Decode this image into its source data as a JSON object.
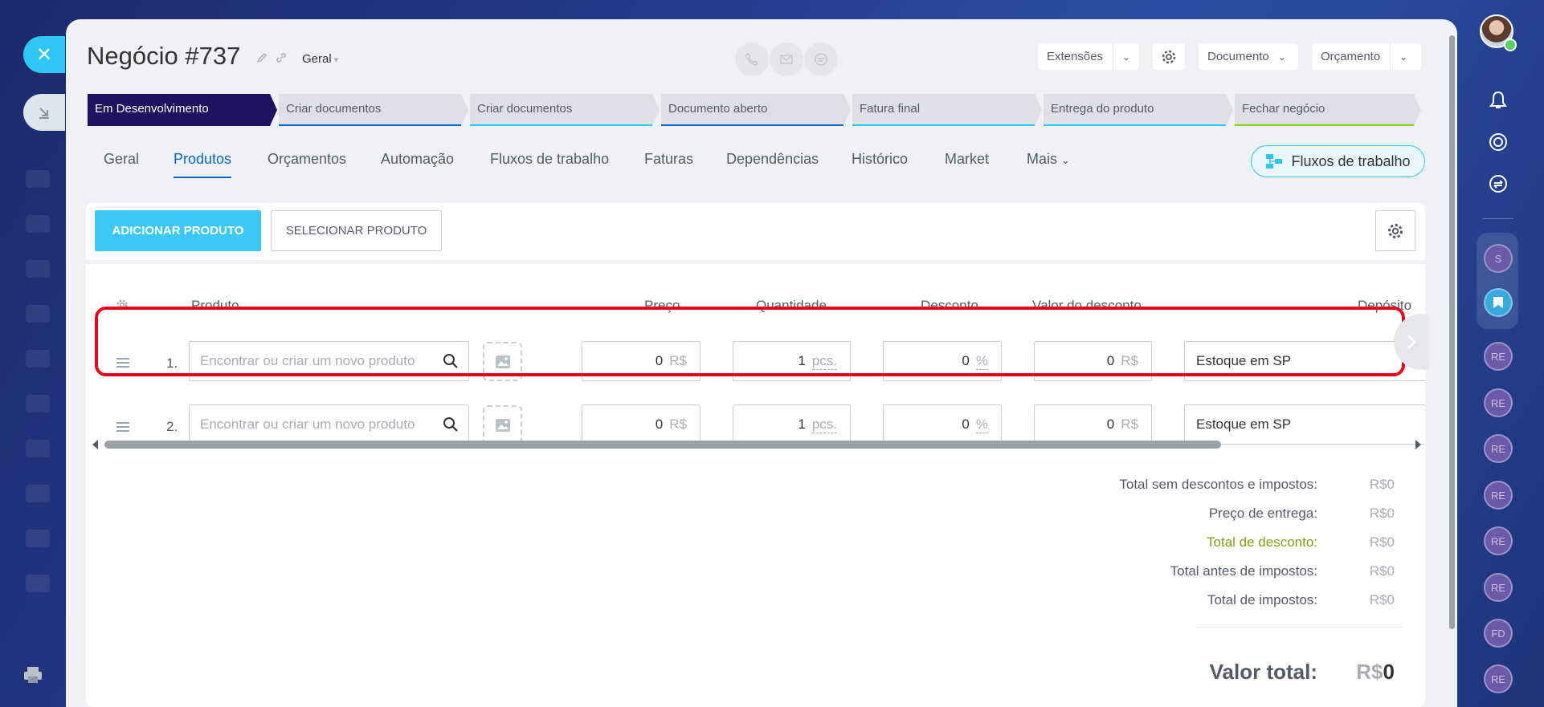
{
  "deal": {
    "title": "Negócio #737",
    "category": "Geral"
  },
  "header_buttons": {
    "extensions": "Extensões",
    "document": "Documento",
    "quote": "Orçamento"
  },
  "stages": [
    {
      "label": "Em Desenvolvimento",
      "color": "#1e1360"
    },
    {
      "label": "Criar documentos",
      "color": "#0b66c3"
    },
    {
      "label": "Criar documentos",
      "color": "#2fc6f6"
    },
    {
      "label": "Documento aberto",
      "color": "#0b66c3"
    },
    {
      "label": "Fatura final",
      "color": "#2fc6f6"
    },
    {
      "label": "Entrega do produto",
      "color": "#2fc6f6"
    },
    {
      "label": "Fechar negócio",
      "color": "#7bd500"
    }
  ],
  "tabs": [
    "Geral",
    "Produtos",
    "Orçamentos",
    "Automação",
    "Fluxos de trabalho",
    "Faturas",
    "Dependências",
    "Histórico",
    "Market",
    "Mais"
  ],
  "active_tab": "Produtos",
  "workflow_button": "Fluxos de trabalho",
  "product_buttons": {
    "add": "ADICIONAR PRODUTO",
    "select": "SELECIONAR PRODUTO"
  },
  "table": {
    "headers": {
      "product": "Produto",
      "price": "Preço",
      "quantity": "Quantidade",
      "discount": "Desconto",
      "discount_value": "Valor do desconto",
      "warehouse": "Depósito"
    },
    "rows": [
      {
        "num": "1.",
        "placeholder": "Encontrar ou criar um novo produto",
        "price": "0",
        "price_unit": "R$",
        "qty": "1",
        "qty_unit": "pcs.",
        "discount": "0",
        "discount_unit": "%",
        "discount_value": "0",
        "discount_value_unit": "R$",
        "warehouse": "Estoque em SP"
      },
      {
        "num": "2.",
        "placeholder": "Encontrar ou criar um novo produto",
        "price": "0",
        "price_unit": "R$",
        "qty": "1",
        "qty_unit": "pcs.",
        "discount": "0",
        "discount_unit": "%",
        "discount_value": "0",
        "discount_value_unit": "R$",
        "warehouse": "Estoque em SP"
      }
    ]
  },
  "totals": [
    {
      "label": "Total sem descontos e impostos:",
      "value": "R$0"
    },
    {
      "label": "Preço de entrega:",
      "value": "R$0"
    },
    {
      "label": "Total de desconto:",
      "value": "R$0"
    },
    {
      "label": "Total antes de impostos:",
      "value": "R$0"
    },
    {
      "label": "Total de impostos:",
      "value": "R$0"
    }
  ],
  "grand_total": {
    "label": "Valor total:",
    "currency": "R$",
    "amount": "0"
  },
  "sidebar_avatars": [
    "S",
    "RE",
    "RE",
    "RE",
    "RE",
    "RE",
    "RE",
    "FD",
    "RE"
  ]
}
